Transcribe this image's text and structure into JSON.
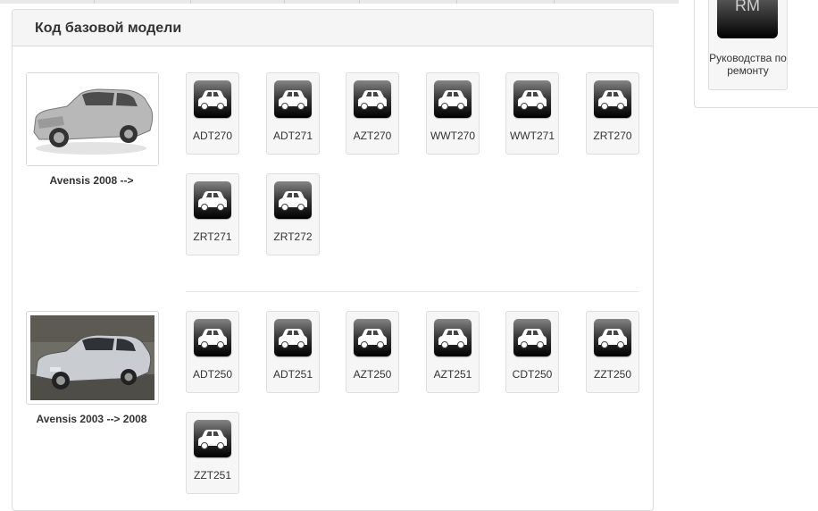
{
  "header": {
    "title": "Код базовой модели"
  },
  "models": [
    {
      "name": "Avensis 2008 -->",
      "codes": [
        "ADT270",
        "ADT271",
        "AZT270",
        "WWT270",
        "WWT271",
        "ZRT270",
        "ZRT271",
        "ZRT272"
      ]
    },
    {
      "name": "Avensis 2003 --> 2008",
      "codes": [
        "ADT250",
        "ADT251",
        "AZT250",
        "AZT251",
        "CDT250",
        "ZZT250",
        "ZZT251"
      ]
    }
  ],
  "sidebar": {
    "repair_icon_text": "RM",
    "repair_label": "Руководства по ремонту"
  },
  "icons": {
    "model_code": "car-icon",
    "repair_manual": "rm-icon"
  }
}
